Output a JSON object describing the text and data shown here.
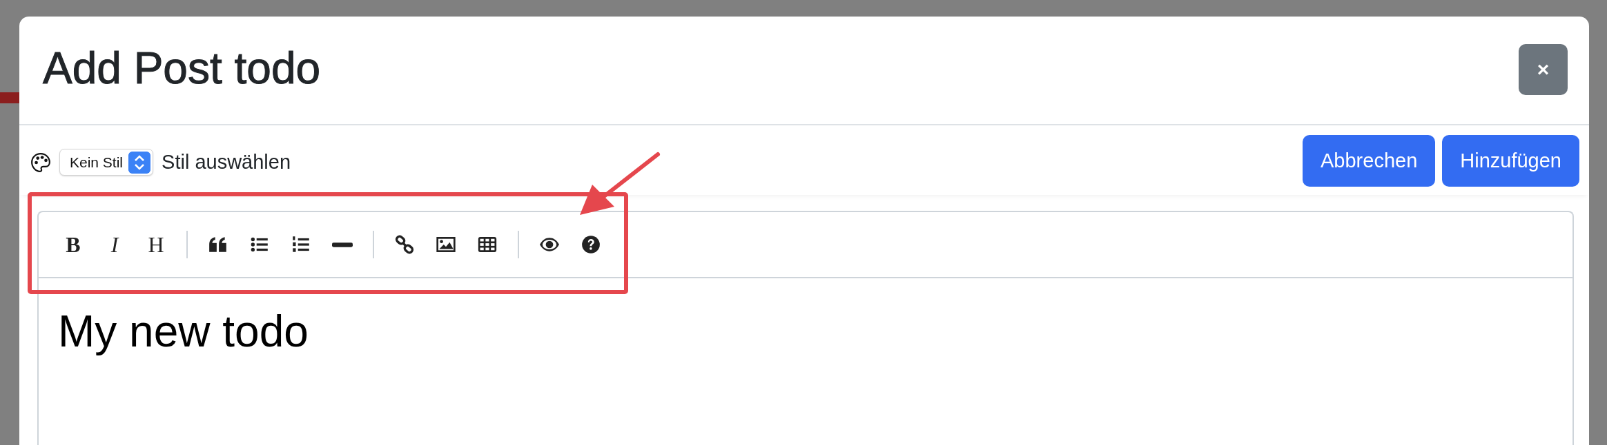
{
  "dialog": {
    "title": "Add Post todo",
    "close_label": "×"
  },
  "style_bar": {
    "select_value": "Kein Stil",
    "label": "Stil auswählen"
  },
  "actions": [
    "Abbrechen",
    "Hinzufügen"
  ],
  "editor": {
    "toolbar": [
      [
        {
          "kind": "bold",
          "label": "B"
        },
        {
          "kind": "italic",
          "label": "I"
        },
        {
          "kind": "heading",
          "label": "H"
        }
      ],
      [
        {
          "kind": "quote"
        },
        {
          "kind": "bullet-list"
        },
        {
          "kind": "numbered-list"
        },
        {
          "kind": "rule"
        }
      ],
      [
        {
          "kind": "link"
        },
        {
          "kind": "image"
        },
        {
          "kind": "table"
        }
      ],
      [
        {
          "kind": "preview"
        },
        {
          "kind": "help"
        }
      ]
    ],
    "content": "My new todo"
  },
  "annotation": {
    "kind": "box-arrow"
  }
}
